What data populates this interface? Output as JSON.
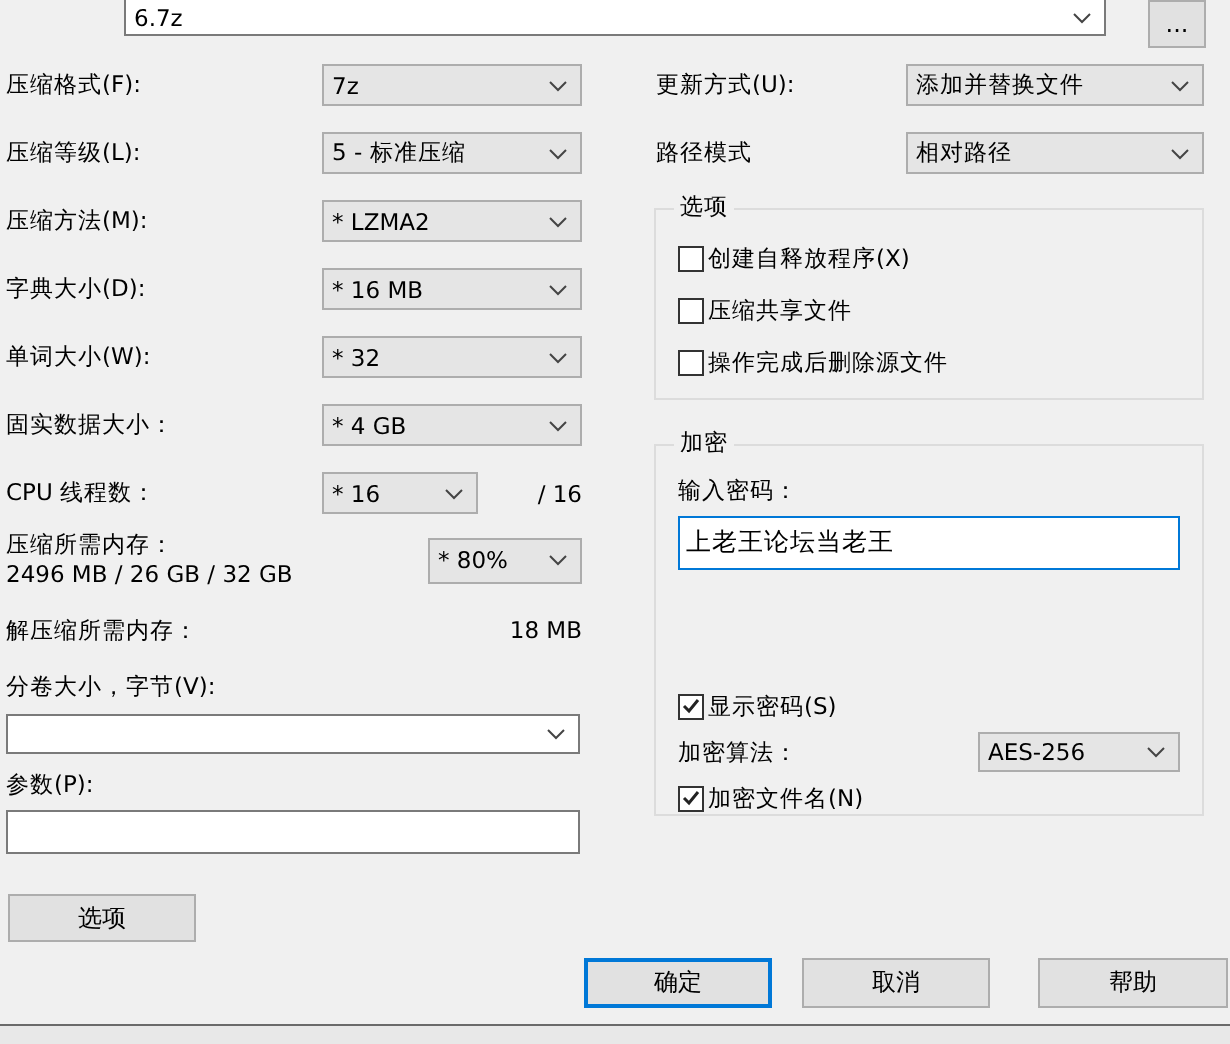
{
  "archive_name": {
    "value": "6.7z"
  },
  "browse_button": "...",
  "left_fields": [
    {
      "label": "压缩格式(F):",
      "value": "7z"
    },
    {
      "label": "压缩等级(L):",
      "value": "5 - 标准压缩"
    },
    {
      "label": "压缩方法(M):",
      "value": "* LZMA2"
    },
    {
      "label": "字典大小(D):",
      "value": "* 16 MB"
    },
    {
      "label": "单词大小(W):",
      "value": "* 32"
    },
    {
      "label": "固实数据大小：",
      "value": "* 4 GB"
    }
  ],
  "cpu": {
    "label": "CPU 线程数：",
    "value": "* 16",
    "max": "/ 16"
  },
  "memory": {
    "label": "压缩所需内存：",
    "detail": "2496 MB / 26 GB / 32 GB",
    "value": "* 80%"
  },
  "decompress_memory": {
    "label": "解压缩所需内存：",
    "value": "18 MB"
  },
  "volume": {
    "label": "分卷大小，字节(V):"
  },
  "parameters": {
    "label": "参数(P):"
  },
  "options_button": "选项",
  "update_mode": {
    "label": "更新方式(U):",
    "value": "添加并替换文件"
  },
  "path_mode": {
    "label": "路径模式",
    "value": "相对路径"
  },
  "options_group": {
    "title": "选项",
    "checkboxes": [
      {
        "label": "创建自释放程序(X)",
        "checked": false
      },
      {
        "label": "压缩共享文件",
        "checked": false
      },
      {
        "label": "操作完成后删除源文件",
        "checked": false
      }
    ]
  },
  "encryption": {
    "title": "加密",
    "password_label": "输入密码：",
    "password": "上老王论坛当老王",
    "show_password": {
      "label": "显示密码(S)",
      "checked": true
    },
    "method_label": "加密算法：",
    "method": "AES-256",
    "encrypt_names": {
      "label": "加密文件名(N)",
      "checked": true
    }
  },
  "buttons": [
    {
      "label": "确定",
      "default": true
    },
    {
      "label": "取消",
      "default": false
    },
    {
      "label": "帮助",
      "default": false
    }
  ]
}
